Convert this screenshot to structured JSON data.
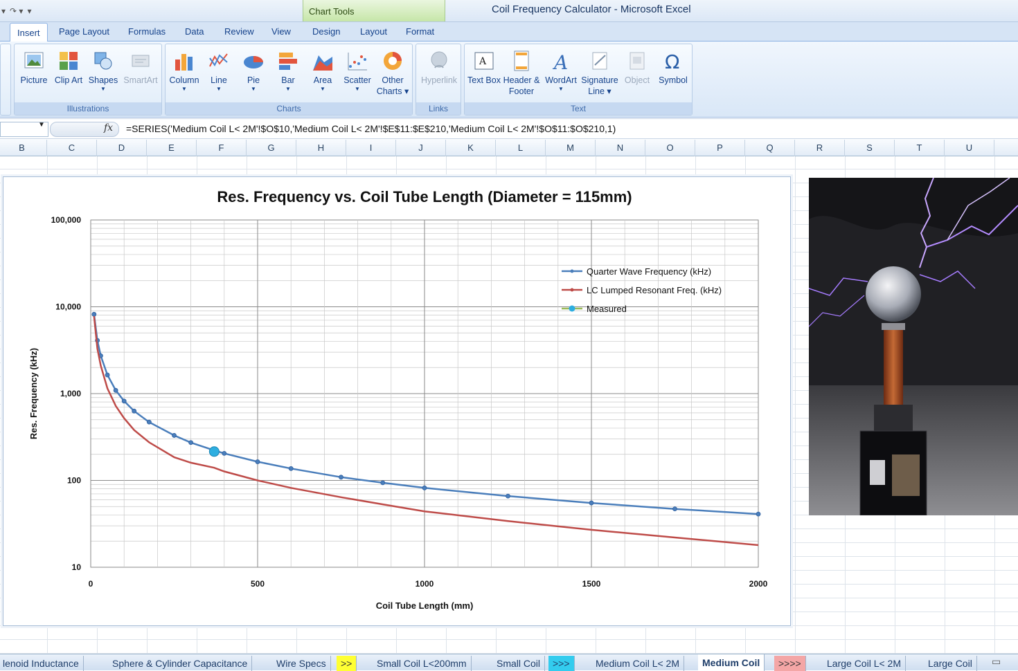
{
  "window": {
    "title": "Coil Frequency Calculator - Microsoft Excel",
    "chart_tools_label": "Chart Tools"
  },
  "tabs": [
    {
      "label": "Insert",
      "active": true
    },
    {
      "label": "Page Layout"
    },
    {
      "label": "Formulas"
    },
    {
      "label": "Data"
    },
    {
      "label": "Review"
    },
    {
      "label": "View"
    },
    {
      "label": "Design"
    },
    {
      "label": "Layout"
    },
    {
      "label": "Format"
    }
  ],
  "ribbon": {
    "illustrations": {
      "label": "Illustrations",
      "picture": "Picture",
      "clip_art": "Clip Art",
      "shapes": "Shapes",
      "smartart": "SmartArt"
    },
    "charts": {
      "label": "Charts",
      "column": "Column",
      "line": "Line",
      "pie": "Pie",
      "bar": "Bar",
      "area": "Area",
      "scatter": "Scatter",
      "other": "Other Charts"
    },
    "links": {
      "label": "Links",
      "hyperlink": "Hyperlink"
    },
    "text": {
      "label": "Text",
      "text_box": "Text Box",
      "header_footer": "Header & Footer",
      "wordart": "WordArt",
      "signature": "Signature Line",
      "object": "Object",
      "symbol": "Symbol"
    }
  },
  "formula_bar": {
    "fx": "fx",
    "formula": "=SERIES('Medium Coil  L< 2M'!$O$10,'Medium Coil  L< 2M'!$E$11:$E$210,'Medium Coil  L< 2M'!$O$11:$O$210,1)"
  },
  "columns": [
    "B",
    "C",
    "D",
    "E",
    "F",
    "G",
    "H",
    "I",
    "J",
    "K",
    "L",
    "M",
    "N",
    "O",
    "P",
    "Q",
    "R",
    "S",
    "T",
    "U"
  ],
  "sheet_tabs": [
    {
      "label": "lenoid Inductance"
    },
    {
      "label": "Sphere & Cylinder Capacitance"
    },
    {
      "label": "Wire Specs"
    },
    {
      "label": ">>",
      "color": "yellow"
    },
    {
      "label": "Small Coil  L<200mm"
    },
    {
      "label": "Small Coil"
    },
    {
      "label": ">>>",
      "color": "cyan"
    },
    {
      "label": "Medium Coil  L< 2M"
    },
    {
      "label": "Medium Coil",
      "active": true
    },
    {
      "label": ">>>>",
      "color": "pink"
    },
    {
      "label": "Large Coil  L< 2M"
    },
    {
      "label": "Large Coil"
    }
  ],
  "chart_data": {
    "type": "line",
    "title": "Res. Frequency vs. Coil Tube Length (Diameter = 115mm)",
    "xlabel": "Coil Tube Length (mm)",
    "ylabel": "Res. Frequency (kHz)",
    "xlim": [
      0,
      2000
    ],
    "ylim": [
      10,
      100000
    ],
    "yscale": "log",
    "x_ticks": [
      "0",
      "500",
      "1000",
      "1500",
      "2000"
    ],
    "y_ticks": [
      "10",
      "100",
      "1,000",
      "10,000",
      "100,000"
    ],
    "grid": true,
    "legend": "top-right",
    "series": [
      {
        "name": "Quarter Wave Frequency (kHz)",
        "color": "#4a7ebb",
        "x": [
          10,
          20,
          30,
          50,
          75,
          100,
          130,
          175,
          250,
          300,
          370,
          400,
          500,
          600,
          750,
          875,
          1000,
          1250,
          1500,
          1750,
          2000
        ],
        "y": [
          8200,
          4100,
          2730,
          1640,
          1090,
          820,
          630,
          470,
          330,
          273,
          222,
          205,
          164,
          137,
          109,
          94,
          82,
          66,
          55,
          47,
          41
        ]
      },
      {
        "name": "LC Lumped Resonant Freq. (kHz)",
        "color": "#be4b48",
        "x": [
          10,
          20,
          30,
          50,
          75,
          100,
          130,
          175,
          250,
          300,
          370,
          400,
          500,
          600,
          750,
          875,
          1000,
          1250,
          1500,
          1750,
          2000
        ],
        "y": [
          7800,
          3300,
          2100,
          1150,
          720,
          520,
          380,
          275,
          185,
          160,
          140,
          127,
          100,
          82,
          64,
          53,
          44,
          34,
          27,
          22,
          18
        ]
      },
      {
        "name": "Measured",
        "color": "#2eaee0",
        "x": [
          370
        ],
        "y": [
          215
        ]
      }
    ]
  }
}
